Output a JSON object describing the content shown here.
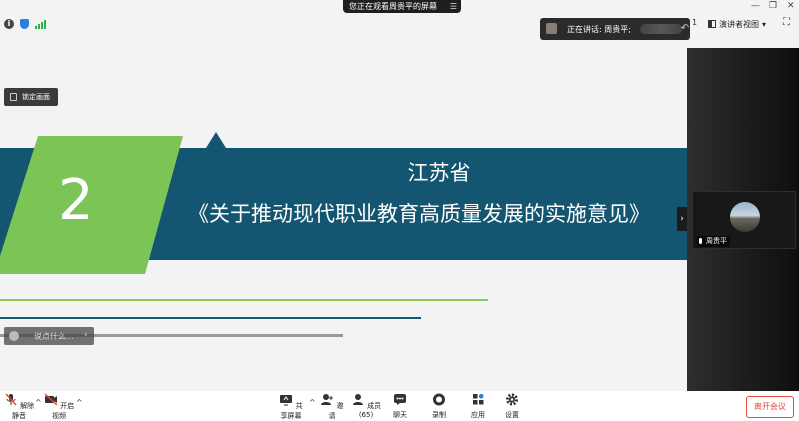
{
  "top": {
    "share_banner": "您正在观看周贵平的屏幕",
    "menu_glyph": "☰",
    "window_controls": [
      "—",
      "❐",
      "✕"
    ],
    "speaker": {
      "label": "正在讲话: 周贵平;"
    },
    "back_glyph": "↶",
    "view_mode": {
      "label": "演讲者视图",
      "caret": "▾",
      "index_glyph": "1"
    },
    "fullscreen_glyph": "⛶"
  },
  "slide": {
    "lock_button": "锁定画面",
    "number": "2",
    "title_line1": "江苏省",
    "title_line2": "《关于推动现代职业教育高质量发展的实施意见》",
    "chat_placeholder": "说点什么...",
    "chat_arrow": "‹",
    "collapse_glyph": "›",
    "colors": {
      "band": "#145671",
      "green": "#7dc456",
      "green_line": "#8cc85a"
    }
  },
  "participant": {
    "name": "周贵平"
  },
  "toolbar": {
    "unmute": "解除静音",
    "start_video": "开启视频",
    "share_screen": "共享屏幕",
    "invite": "邀请",
    "members": "成员(65)",
    "chat": "聊天",
    "record": "录制",
    "apps": "应用",
    "settings": "设置",
    "leave": "离开会议",
    "caret": "^"
  }
}
